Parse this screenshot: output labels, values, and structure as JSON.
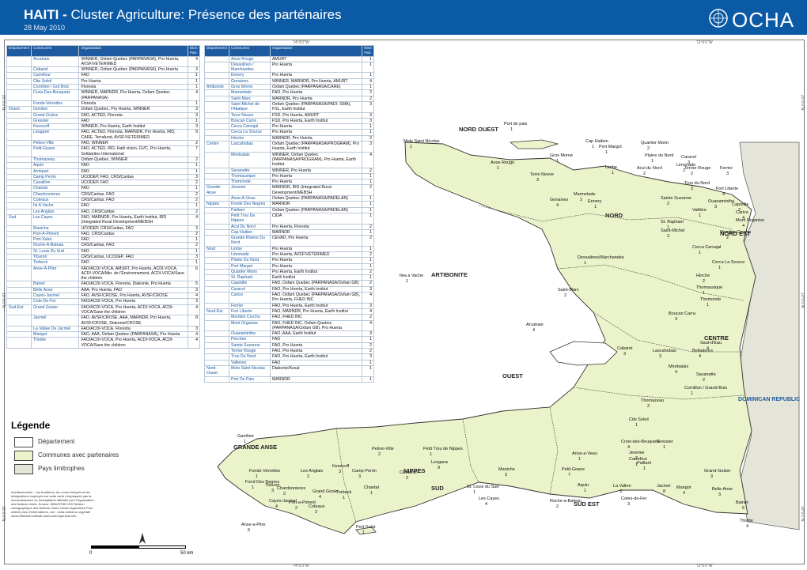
{
  "header": {
    "title_bold": "HAITI -",
    "title_rest": " Cluster Agriculture: Présence des parténaires",
    "date": "28 May  2010",
    "logo_text": "OCHA"
  },
  "coords": {
    "top_left": "74°0'0\"W",
    "top_right": "72°0'0\"W",
    "bottom_left": "74°0'0\"W",
    "bottom_right": "72°0'0\"W",
    "left_top": "20°0'0\"N",
    "left_mid": "19°0'0\"N",
    "left_bot": "18°0'0\"N",
    "right_top": "20°0'0\"N",
    "right_mid": "19°0'0\"N",
    "right_bot": "18°0'0\"N"
  },
  "table_headers": [
    "Département",
    "Communes",
    "Organisation",
    "Nbre Part."
  ],
  "table_left": [
    [
      "",
      "Arcahaie",
      "WINNER, Oxfam Quebec (PARPANASA), Pro Huerta, AVSF/VETERIMED",
      "4"
    ],
    [
      "",
      "Cabaret",
      "WINNER, Oxfam Quebec (PARPANASA), Pro Huerta",
      "3"
    ],
    [
      "",
      "Carrefour",
      "FAO",
      "1"
    ],
    [
      "",
      "Cite Soleil",
      "Pro Huerta",
      "1"
    ],
    [
      "",
      "Cornillon / Grd Bois",
      "Floresta",
      "1"
    ],
    [
      "",
      "Croix-Des-Bouquets",
      "WINNER, MARNDR, Pro Huerta, Oxfam Quebec (PARPANASA)",
      "4"
    ],
    [
      "",
      "Fonds-Verrettes",
      "Floresta",
      "1"
    ],
    [
      "Ouest",
      "Gonâve",
      "Oxfam Quebec, Pro Huerta, WINNER",
      "3"
    ],
    [
      "",
      "Grand-Goâve",
      "FAO, ACTED, Floresta",
      "3"
    ],
    [
      "",
      "Gressier",
      "FAO",
      "1"
    ],
    [
      "",
      "Kenscoff",
      "WINNER, Pro Huerta, Earth Institut",
      "3"
    ],
    [
      "",
      "Léogane",
      "FAO, ACTED, Floresta, MARNDR, Pro Huerta, IRD, CARE, Terrafund, AVSF/VETERIMED",
      "9"
    ],
    [
      "",
      "Pétion-Ville",
      "FAO, WINNER",
      "2"
    ],
    [
      "",
      "Petit-Goave",
      "FAO, ACTED, IRD, Haiti vision, GVC, Pro Huerta, Solidarites International",
      "7"
    ],
    [
      "",
      "Thomazeau",
      "Oxfam Quebec, WINNER",
      "2"
    ],
    [
      "",
      "Aquin",
      "FAO",
      "1"
    ],
    [
      "",
      "Arniquet",
      "FAO",
      "1"
    ],
    [
      "",
      "Camp Perrin",
      "UCODEP, FAO, CRS/Caritas",
      "3"
    ],
    [
      "",
      "Cavaillon",
      "UCODEP, FAO",
      "2"
    ],
    [
      "",
      "Chantal",
      "FAO",
      "1"
    ],
    [
      "",
      "Chardonnieres",
      "CRS/Caritas, FAO",
      "2"
    ],
    [
      "",
      "Coteaux",
      "CRS/Caritas, FAO",
      "2"
    ],
    [
      "",
      "Ile A Vache",
      "FAO",
      "1"
    ],
    [
      "",
      "Les Anglais",
      "FAO, CRS/Caritas",
      "2"
    ],
    [
      "Sud",
      "Les Cayes",
      "FAO, MARNDR, Pro Huerta, Earth Institut, IRD (Integrated Rural Development/MEBSH",
      "4"
    ],
    [
      "",
      "Maniche",
      "UCODEP, CRS/Caritas, FAO",
      "3"
    ],
    [
      "",
      "Port-A-Piment",
      "FAO, CRS/Caritas",
      "2"
    ],
    [
      "",
      "Port-Salut",
      "FAO",
      "1"
    ],
    [
      "",
      "Roche-A-Bateau",
      "CRS/Caritas, FAO",
      "2"
    ],
    [
      "",
      "St. Louis Du Sud",
      "FAO",
      "1"
    ],
    [
      "",
      "Tiburon",
      "CRS/Caritas, UCODEP, FAO",
      "3"
    ],
    [
      "",
      "Torbeck",
      "FAO",
      "1"
    ],
    [
      "",
      "Anse-A-Pitre",
      "FAO/ACDI-VOCA, AMURT, Pro Huerta, ACDI-VOCA, ACDI-VOCA/Min. de l'Environnement, ACDI-VOCA/Save the children",
      "6"
    ],
    [
      "",
      "Bainet",
      "FAO/ACDI-VOCA, Floresta, Diakonie, Pro Huerta",
      "5"
    ],
    [
      "",
      "Belle Anse",
      "AAA, Pro Huerta, FAO",
      "3"
    ],
    [
      "",
      "Cayes-Jacmel",
      "FAO, AVSF/CROSE, Pro Huerta, AVSF/CROSE",
      "4"
    ],
    [
      "",
      "Cote-De-Fer",
      "FAO/ACDI-VOCA, Pro Huerta",
      "3"
    ],
    [
      "Sud-Est",
      "Grand Gosier",
      "FAO/ACDI-VOCA, Pro Huerta, ACDI-VOCA, ACDI-VOCA/Save the children",
      "4"
    ],
    [
      "",
      "Jacmel",
      "FAO, AVSF/CROSE, AAA, MARNDR, Pro Huerta, AVSF/CROSE, Diakonie/CROSE",
      "8"
    ],
    [
      "",
      "La Vallee De Jacmel",
      "FAO/ACDI-VOCA, Floresta",
      "3"
    ],
    [
      "",
      "Marigot",
      "FAO, AAA, Oxfam Quebec (PARPANASA), Pro Huerta",
      "4"
    ],
    [
      "",
      "Thiotte",
      "FAO/ACDI-VOCA, Pro Huerta, ACDI-VOCA, ACDI-VOCA/Save the children",
      "4"
    ]
  ],
  "table_right": [
    [
      "",
      "Anse Rouge",
      "AMURT",
      "1"
    ],
    [
      "",
      "Desaulines / Marchandes",
      "Pro Huerta",
      "1"
    ],
    [
      "",
      "Ennery",
      "Pro Huerta",
      "1"
    ],
    [
      "",
      "Gonaives",
      "WINNER, MARNDR, Pro Huerta, AMURT",
      "4"
    ],
    [
      "Artibonite",
      "Gros Morne",
      "Oxfam Quebec (PARPANASA/CARE)",
      "1"
    ],
    [
      "",
      "Marmelade",
      "FAO, Pro Huerta",
      "2"
    ],
    [
      "",
      "Saint-Marc",
      "MARNDR, Pro Huerta",
      "2"
    ],
    [
      "",
      "Saint-Michel de l'Attalaye",
      "Oxfam Quebec (PARPANASA/PADI- SMA), FSL, Earth Institut",
      "3"
    ],
    [
      "",
      "Terre Neuve",
      "FSD, Pro Huerta, AMURT",
      "3"
    ],
    [
      "",
      "Boucan Carre",
      "FSD, Pro Huerta, Earth Institut",
      "3"
    ],
    [
      "",
      "Cerca Carvajal",
      "Pro Huerta",
      "1"
    ],
    [
      "",
      "Cerca La Source",
      "Pro Huerta",
      "1"
    ],
    [
      "",
      "Hinche",
      "MARNDR, Pro Huerta",
      "2"
    ],
    [
      "Centre",
      "Lascahobas",
      "Oxfam Quebec (PARPANASA/PROGRAM), Pro Huerta, Earth Institut",
      "3"
    ],
    [
      "",
      "Mirebalais",
      "WINNER, Oxfam Quebec (PARPANASA/PROGRAM), Pro Huerta, Earth Institut",
      "4"
    ],
    [
      "",
      "Savanette",
      "WINNER, Pro Huerta",
      "2"
    ],
    [
      "",
      "Thomassique",
      "Pro Huerta",
      "1"
    ],
    [
      "",
      "Thomonde",
      "Pro Huerta",
      "1"
    ],
    [
      "Grande-Anse",
      "Jeremie",
      "MARNDR, IRD (Integrated Rural Development/MEBSH",
      "2"
    ],
    [
      "",
      "Anse-A-Veau",
      "Oxfam Quebec (PARPANASA/PADELAN)",
      "1"
    ],
    [
      "Nippes",
      "Fonds Des Negres",
      "MARNDR",
      "1"
    ],
    [
      "",
      "Paillant",
      "Oxfam Quebec (PARPANASA/PADELAN)",
      "1"
    ],
    [
      "",
      "Petit Trou De Nippes",
      "CIDA",
      "1"
    ],
    [
      "",
      "Acul Du Nord",
      "Pro Huerta, Floresta",
      "2"
    ],
    [
      "",
      "Cap Haitien",
      "MARNDR",
      "1"
    ],
    [
      "",
      "Grande Riviere Du Nord",
      "CEVAD, Pro Huerta",
      "2"
    ],
    [
      "Nord",
      "Limbe",
      "Pro Huerta",
      "1"
    ],
    [
      "",
      "Limonade",
      "Pro Huerta, AVSF/VETERIMED",
      "2"
    ],
    [
      "",
      "Plaine Du Nord",
      "Pro Huerta",
      "1"
    ],
    [
      "",
      "Port Margot",
      "Pro Huerta",
      "1"
    ],
    [
      "",
      "Quartier Morin",
      "Pro Huerta, Earth Institut",
      "2"
    ],
    [
      "",
      "St. Raphael",
      "Earth Institut",
      "1"
    ],
    [
      "",
      "Capotille",
      "FAO, Oxfam Quebec (PARPANASA/Oxfam GB)",
      "2"
    ],
    [
      "",
      "Caracol",
      "FAO, Pro Huerta, Earth Institut",
      "3"
    ],
    [
      "",
      "Carice",
      "FAO, Oxfam Quebec (PARPANASA/Oxfam GB), Pro Huerta, FHED INC",
      "4"
    ],
    [
      "",
      "Ferrier",
      "FAO, Pro Huerta, Earth Institut",
      "3"
    ],
    [
      "Nord-Est",
      "Fort Liberte",
      "FAO, MARNDR, Pro Huerta, Earth Institut",
      "4"
    ],
    [
      "",
      "Mombin Crochu",
      "FAO, FHED INC",
      "2"
    ],
    [
      "",
      "Mont Organise",
      "FAO, FHED INC, Oxfam Quebec (PARPANASA/Oxfam GB), Pro Huerta",
      "4"
    ],
    [
      "",
      "Ouanaminthe",
      "FAO, AAA, Earth Institut",
      "3"
    ],
    [
      "",
      "Perches",
      "FAO",
      "1"
    ],
    [
      "",
      "Sainte Suzanne",
      "FAO, Pro Huerta",
      "2"
    ],
    [
      "",
      "Terrier Rouge",
      "FAO, Pro Huerta",
      "2"
    ],
    [
      "",
      "Trou Du Nord",
      "FAO, Pro Huerta, Earth Institut",
      "3"
    ],
    [
      "",
      "Vallieres",
      "FAO",
      "1"
    ],
    [
      "Nord-Ouest",
      "Mole Saint Nicolas",
      "Diakonie/Kesal",
      "1"
    ],
    [
      "",
      "Port De Paix",
      "MARNDR",
      "1"
    ]
  ],
  "map_labels": {
    "dept": [
      "NORD OUEST",
      "NORD",
      "NORD EST",
      "ARTIBONITE",
      "CENTRE",
      "OUEST",
      "GRANDE ANSE",
      "NIPPES",
      "SUD",
      "SUD EST"
    ],
    "dominican": "DOMINICAN REPUBLIC",
    "communes": [
      {
        "n": "Mole Saint Nicolas",
        "c": "1"
      },
      {
        "n": "Port de paix",
        "c": "1"
      },
      {
        "n": "Cap Haitien",
        "c": "1"
      },
      {
        "n": "Quartier Morin",
        "c": "2"
      },
      {
        "n": "Port Margot",
        "c": "1"
      },
      {
        "n": "Plaine du Nord",
        "c": "1"
      },
      {
        "n": "Caracol",
        "c": "3"
      },
      {
        "n": "Anse Rouge",
        "c": "1"
      },
      {
        "n": "Limbe",
        "c": "1"
      },
      {
        "n": "Limonade",
        "c": "2"
      },
      {
        "n": "Gros Morne",
        "c": "1"
      },
      {
        "n": "Acul du Nord",
        "c": "2"
      },
      {
        "n": "Terrier Rouge",
        "c": "2"
      },
      {
        "n": "Ferrier",
        "c": "3"
      },
      {
        "n": "Terre Neuve",
        "c": "3"
      },
      {
        "n": "Trou du Nord",
        "c": "3"
      },
      {
        "n": "Fort Liberte",
        "c": "4"
      },
      {
        "n": "Marmelade",
        "c": "2"
      },
      {
        "n": "Sainte Suzanne",
        "c": "2"
      },
      {
        "n": "Ouanaminthe",
        "c": "3"
      },
      {
        "n": "Gonaives",
        "c": "4"
      },
      {
        "n": "Ennery",
        "c": "1"
      },
      {
        "n": "Capotille",
        "c": "2"
      },
      {
        "n": "Vallière",
        "c": "1"
      },
      {
        "n": "Carice",
        "c": "4"
      },
      {
        "n": "Mont Organise",
        "c": "4"
      },
      {
        "n": "St. Raphael",
        "c": "1"
      },
      {
        "n": "Saint-Michel",
        "c": "3"
      },
      {
        "n": "Mombin Crochu",
        "c": "2"
      },
      {
        "n": "Dessalines/Marchandes",
        "c": "1"
      },
      {
        "n": "Cerca Carvajal",
        "c": "1"
      },
      {
        "n": "Cerca La Source",
        "c": "1"
      },
      {
        "n": "Hinche",
        "c": "2"
      },
      {
        "n": "Saint-Marc",
        "c": "2"
      },
      {
        "n": "Thomassique",
        "c": "1"
      },
      {
        "n": "Thomonde",
        "c": "1"
      },
      {
        "n": "Boucan Carra",
        "c": "3"
      },
      {
        "n": "Arcahaie",
        "c": "4"
      },
      {
        "n": "Lascahobas",
        "c": "3"
      },
      {
        "n": "Belladeres",
        "c": "4"
      },
      {
        "n": "Saut-d'Eau",
        "c": "4"
      },
      {
        "n": "Mirebalais",
        "c": "4"
      },
      {
        "n": "Cabaret",
        "c": "3"
      },
      {
        "n": "Savanette",
        "c": "2"
      },
      {
        "n": "Cornillon / Grand-Bois",
        "c": "1"
      },
      {
        "n": "Thomazeau",
        "c": "2"
      },
      {
        "n": "Cite Soleil",
        "c": "1"
      },
      {
        "n": "Croix-des-Bouquets",
        "c": "4"
      },
      {
        "n": "Gressier",
        "c": "1"
      },
      {
        "n": "Ganthier",
        "c": "1"
      },
      {
        "n": "Jeremie",
        "c": "2"
      },
      {
        "n": "Carrefour",
        "c": "1"
      },
      {
        "n": "Petion-Ville",
        "c": "2"
      },
      {
        "n": "Petit Trou de Nippes",
        "c": "1"
      },
      {
        "n": "Anse-a-Veau",
        "c": "1"
      },
      {
        "n": "Leogane",
        "c": "9"
      },
      {
        "n": "Paillant",
        "c": "1"
      },
      {
        "n": "Kenscoff",
        "c": "3"
      },
      {
        "n": "Maniche",
        "c": "3"
      },
      {
        "n": "Petit-Goave",
        "c": "7"
      },
      {
        "n": "Grand-Goâve",
        "c": "3"
      },
      {
        "n": "Fonds-Verrettes",
        "c": "1"
      },
      {
        "n": "Les Anglais",
        "c": "2"
      },
      {
        "n": "Camp Perrin",
        "c": "3"
      },
      {
        "n": "Cavaillon",
        "c": "2"
      },
      {
        "n": "Fond Des Negres",
        "c": "1"
      },
      {
        "n": "Tiburon",
        "c": "3"
      },
      {
        "n": "Chardonnieres",
        "c": "2"
      },
      {
        "n": "Chantal",
        "c": "1"
      },
      {
        "n": "St. Louis du Sud",
        "c": "1"
      },
      {
        "n": "Aquin",
        "c": "1"
      },
      {
        "n": "La Vallee",
        "c": "3"
      },
      {
        "n": "Jacmel",
        "c": "8"
      },
      {
        "n": "Marigot",
        "c": "4"
      },
      {
        "n": "Belle Anse",
        "c": "3"
      },
      {
        "n": "Grand Gosier",
        "c": "4"
      },
      {
        "n": "Torbeck",
        "c": "1"
      },
      {
        "n": "Les Cayes",
        "c": "4"
      },
      {
        "n": "Cotes-de-Fer",
        "c": "3"
      },
      {
        "n": "Cayes-Jacmel",
        "c": "4"
      },
      {
        "n": "Port-a-Piment",
        "c": "2"
      },
      {
        "n": "Coteaux",
        "c": "2"
      },
      {
        "n": "Roche-a-Bateau",
        "c": "2"
      },
      {
        "n": "Bainet",
        "c": "5"
      },
      {
        "n": "Thiotte",
        "c": "4"
      },
      {
        "n": "Anse-a-Pitre",
        "c": "6"
      },
      {
        "n": "Port-Salut",
        "c": "1"
      },
      {
        "n": "Ilea a Vache",
        "c": "1"
      }
    ]
  },
  "legend": {
    "title": "Légende",
    "items": [
      "Département",
      "Communes avec partenaires",
      "Pays limitrophes"
    ],
    "colors": [
      "#ffffff",
      "#eaf3c9",
      "#e4e4d9"
    ]
  },
  "notes": "Avertissements : Les frontières, les noms indiqués et les désignations employés sur cette carte n'impliquent pas la reconnaissance ou l'acceptation officielle par l'Organisation des Nations Unies.  Source: MINUSTAH GIS Section cartographique des Nations Unies Cluster Agriculture  Pour obtenir plus d'informations, voir : ocha.online.un.org/haiti www.reliefweb.int/haiti www.cnlm/operacle.info",
  "scale": {
    "zero": "0",
    "max": "50 km"
  },
  "colors": {
    "header": "#0b5aa6",
    "sea": "#ffffff",
    "land": "#eaf3c9",
    "dr": "#e4e4d9",
    "border": "#333333",
    "accent": "#1d5aa0"
  }
}
